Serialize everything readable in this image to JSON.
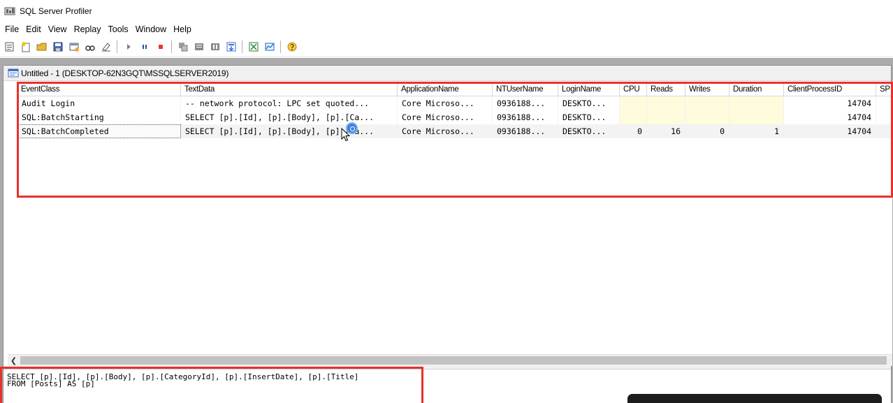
{
  "window": {
    "title": "SQL Server Profiler"
  },
  "menu": [
    "File",
    "Edit",
    "View",
    "Replay",
    "Tools",
    "Window",
    "Help"
  ],
  "toolbar": {
    "buttons": [
      "new-trace-icon",
      "new-template-icon",
      "open-icon",
      "save-icon",
      "properties-icon",
      "find-icon",
      "clear-icon",
      "start-icon",
      "pause-icon",
      "stop-icon",
      "replay-icon",
      "step-icon",
      "run-to-cursor-icon",
      "auto-scroll-icon",
      "performance-monitor-icon",
      "database-tuning-icon",
      "help-icon"
    ]
  },
  "child_window": {
    "title": "Untitled - 1 (DESKTOP-62N3GQT\\MSSQLSERVER2019)"
  },
  "grid": {
    "columns": [
      "EventClass",
      "TextData",
      "ApplicationName",
      "NTUserName",
      "LoginName",
      "CPU",
      "Reads",
      "Writes",
      "Duration",
      "ClientProcessID",
      "SP"
    ],
    "rows": [
      [
        "Audit Login",
        "-- network protocol: LPC  set quoted...",
        "Core Microso...",
        "0936188...",
        "DESKTO...",
        "",
        "",
        "",
        "",
        "14704",
        ""
      ],
      [
        "SQL:BatchStarting",
        "SELECT [p].[Id], [p].[Body], [p].[Ca...",
        "Core Microso...",
        "0936188...",
        "DESKTO...",
        "",
        "",
        "",
        "",
        "14704",
        ""
      ],
      [
        "SQL:BatchCompleted",
        "SELECT [p].[Id], [p].[Body], [p].[Ca...",
        "Core Microso...",
        "0936188...",
        "DESKTO...",
        "0",
        "16",
        "0",
        "1",
        "14704",
        ""
      ]
    ],
    "selected_row": 2
  },
  "detail": {
    "line1": "SELECT [p].[Id], [p].[Body], [p].[CategoryId], [p].[InsertDate], [p].[Title]",
    "line2": "FROM [Posts] AS [p]"
  },
  "colors": {
    "highlight": "#e8312b",
    "mdi_background": "#ababab",
    "pending_cell": "#fffbdd"
  }
}
